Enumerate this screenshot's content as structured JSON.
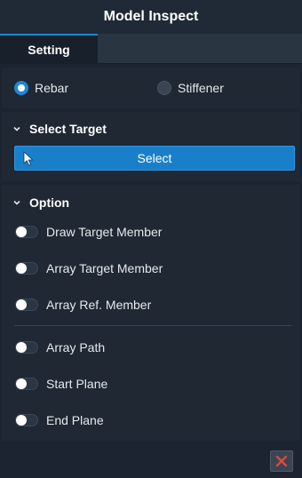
{
  "window": {
    "title": "Model Inspect"
  },
  "tabs": [
    {
      "label": "Setting",
      "active": true
    }
  ],
  "mode": {
    "options": [
      {
        "label": "Rebar",
        "selected": true
      },
      {
        "label": "Stiffener",
        "selected": false
      }
    ]
  },
  "select_target": {
    "header": "Select Target",
    "button_label": "Select"
  },
  "option": {
    "header": "Option",
    "toggles": [
      {
        "label": "Draw Target Member",
        "on": false
      },
      {
        "label": "Array Target Member",
        "on": false
      },
      {
        "label": "Array Ref. Member",
        "on": false
      },
      {
        "label": "Array Path",
        "on": false
      },
      {
        "label": "Start Plane",
        "on": false
      },
      {
        "label": "End Plane",
        "on": false
      }
    ]
  },
  "colors": {
    "accent": "#1e88d8",
    "background": "#1b2430",
    "panel": "#1f2833",
    "close_icon": "#e0483b"
  },
  "icons": {
    "section_chevron": "chevron-down-icon",
    "select": "cursor-arrow-icon",
    "close": "close-icon"
  }
}
